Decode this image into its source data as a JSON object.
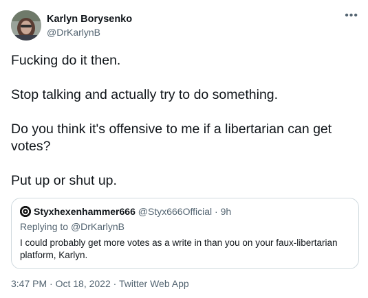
{
  "author": {
    "name": "Karlyn Borysenko",
    "handle": "@DrKarlynB"
  },
  "more_icon": "•••",
  "tweet_paragraphs": [
    "Fucking do it then.",
    "Stop talking and actually try to do something.",
    "Do you think it's offensive to me if a libertarian can get votes?",
    "Put up or shut up."
  ],
  "quote": {
    "name": "Styxhexenhammer666",
    "handle": "@Styx666Official",
    "separator": "·",
    "time": "9h",
    "replying_prefix": "Replying to ",
    "replying_to": "@DrKarlynB",
    "text": "I could probably get more votes as a write in than you on your faux-libertarian platform, Karlyn."
  },
  "footer": {
    "time": "3:47 PM",
    "separator1": "·",
    "date": "Oct 18, 2022",
    "separator2": "·",
    "source": "Twitter Web App"
  }
}
